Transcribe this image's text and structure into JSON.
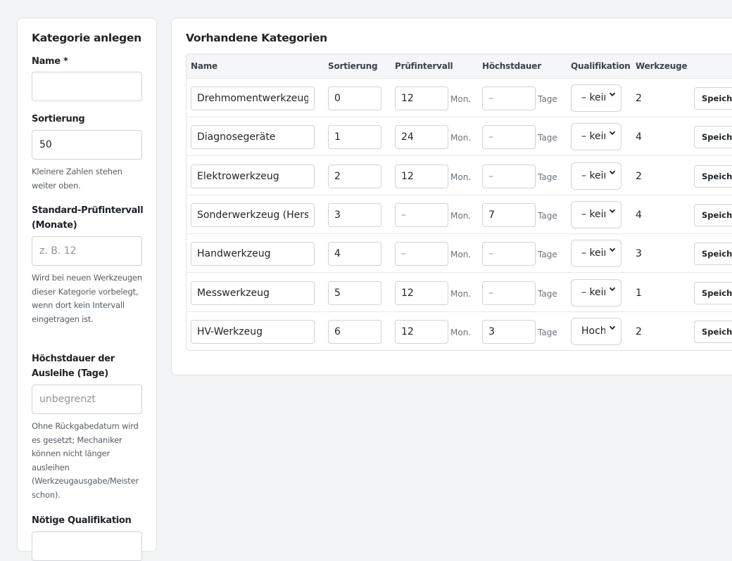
{
  "create": {
    "title": "Kategorie anlegen",
    "name_label": "Name *",
    "name_value": "",
    "sort_label": "Sortierung",
    "sort_value": "50",
    "sort_help": "Kleinere Zahlen stehen weiter oben.",
    "interval_label": "Standard-Prüfintervall (Monate)",
    "interval_placeholder": "z. B. 12",
    "interval_help": "Wird bei neuen Werkzeugen dieser Kategorie vorbelegt, wenn dort kein Intervall eingetragen ist.",
    "maxdur_label": "Höchstdauer der Ausleihe (Tage)",
    "maxdur_placeholder": "unbegrenzt",
    "maxdur_help": "Ohne Rückgabedatum wird es gesetzt; Mechaniker können nicht länger ausleihen (Werkzeugausgabe/Meister schon).",
    "qual_label": "Nötige Qualifikation"
  },
  "list": {
    "title": "Vorhandene Kategorien",
    "columns": [
      "Name",
      "Sortierung",
      "Prüfintervall",
      "Höchstdauer",
      "Qualifikation",
      "Werkzeuge"
    ],
    "empty_placeholder": "–",
    "unit_months": "Mon.",
    "unit_days": "Tage",
    "save_label": "Speichern",
    "rows": [
      {
        "name": "Drehmomentwerkzeug",
        "sort": "0",
        "interval": "12",
        "maxdur": "",
        "qual": "– keine –",
        "count": "2"
      },
      {
        "name": "Diagnosegeräte",
        "sort": "1",
        "interval": "24",
        "maxdur": "",
        "qual": "– keine –",
        "count": "4"
      },
      {
        "name": "Elektrowerkzeug",
        "sort": "2",
        "interval": "12",
        "maxdur": "",
        "qual": "– keine –",
        "count": "2"
      },
      {
        "name": "Sonderwerkzeug (Hersteller)",
        "sort": "3",
        "interval": "",
        "maxdur": "7",
        "qual": "– keine –",
        "count": "4"
      },
      {
        "name": "Handwerkzeug",
        "sort": "4",
        "interval": "",
        "maxdur": "",
        "qual": "– keine –",
        "count": "3"
      },
      {
        "name": "Messwerkzeug",
        "sort": "5",
        "interval": "12",
        "maxdur": "",
        "qual": "– keine –",
        "count": "1"
      },
      {
        "name": "HV-Werkzeug",
        "sort": "6",
        "interval": "12",
        "maxdur": "3",
        "qual": "Hochvolt",
        "count": "2"
      }
    ]
  }
}
